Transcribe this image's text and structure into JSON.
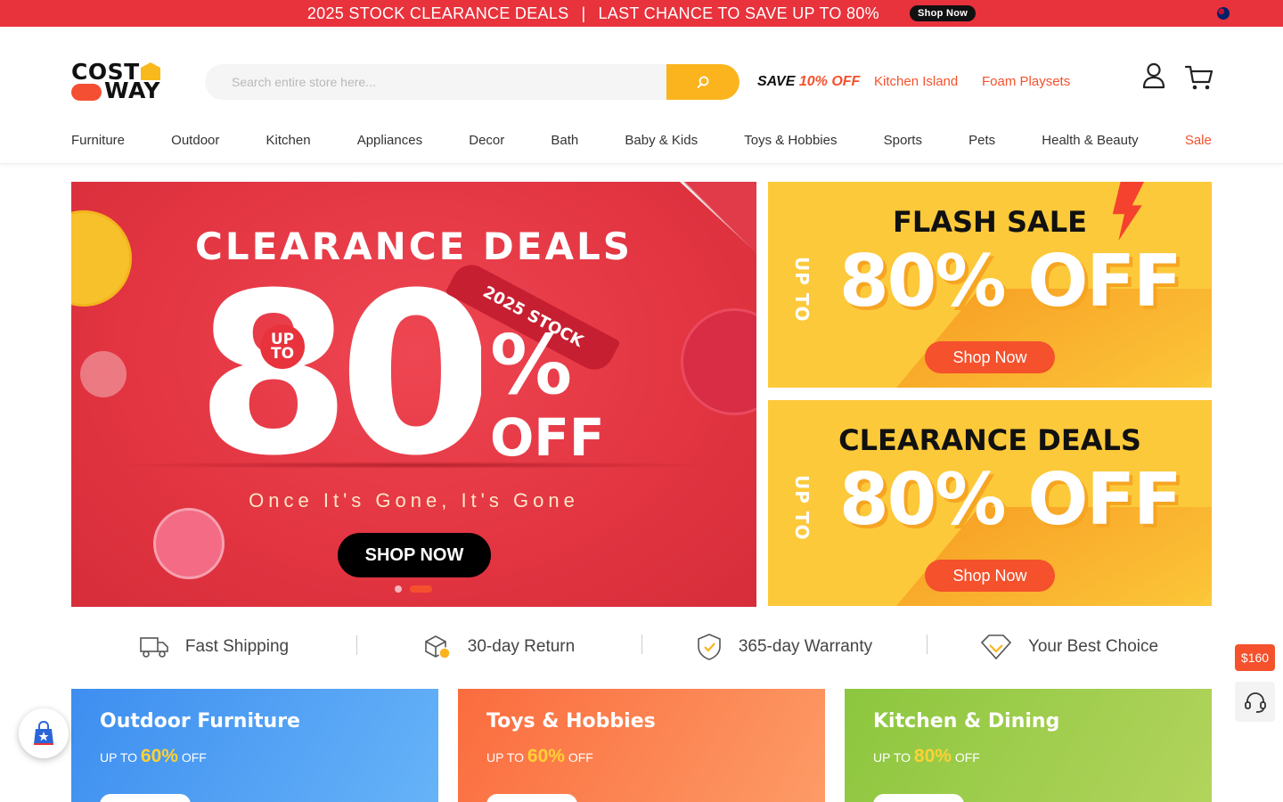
{
  "topbar": {
    "left_text": "2025 STOCK CLEARANCE DEALS",
    "separator": "|",
    "right_text": "LAST CHANCE TO SAVE UP TO 80%",
    "shop_label": "Shop Now",
    "flag_icon": "australia-flag-icon"
  },
  "header": {
    "logo_line1": "COST",
    "logo_line2": "WAY",
    "search_placeholder": "Search entire store here...",
    "promo_save": "SAVE",
    "promo_off": "10% OFF",
    "hot_links": [
      "Kitchen Island",
      "Foam Playsets"
    ]
  },
  "nav": {
    "items": [
      "Furniture",
      "Outdoor",
      "Kitchen",
      "Appliances",
      "Decor",
      "Bath",
      "Baby & Kids",
      "Toys & Hobbies",
      "Sports",
      "Pets",
      "Health & Beauty",
      "Sale"
    ]
  },
  "hero": {
    "title": "CLEARANCE DEALS",
    "up_to": "UP TO",
    "big_number": "80",
    "percent": "%",
    "off": "OFF",
    "ribbon": "2025 STOCK",
    "tagline": "Once It's Gone, It's Gone",
    "cta": "SHOP NOW",
    "slide_count": 2,
    "active_slide": 2
  },
  "side_banners": [
    {
      "heading": "FLASH SALE",
      "up_to": "UP TO",
      "value": "80% OFF",
      "cta": "Shop Now"
    },
    {
      "heading": "CLEARANCE DEALS",
      "up_to": "UP TO",
      "value": "80% OFF",
      "cta": "Shop Now"
    }
  ],
  "features": [
    {
      "label": "Fast Shipping",
      "icon": "truck-icon"
    },
    {
      "label": "30-day Return",
      "icon": "return-box-icon"
    },
    {
      "label": "365-day Warranty",
      "icon": "shield-check-icon"
    },
    {
      "label": "Your Best Choice",
      "icon": "diamond-icon"
    }
  ],
  "categories": [
    {
      "title": "Outdoor Furniture",
      "prefix": "UP TO",
      "percent": "60%",
      "suffix": "OFF",
      "color": "#4a9ef0"
    },
    {
      "title": "Toys & Hobbies",
      "prefix": "UP TO",
      "percent": "60%",
      "suffix": "OFF",
      "color": "#fa7a4a"
    },
    {
      "title": "Kitchen & Dining",
      "prefix": "UP TO",
      "percent": "80%",
      "suffix": "OFF",
      "color": "#8ec63f"
    }
  ],
  "floating": {
    "coupon_badge": "$160"
  },
  "colors": {
    "brand_red": "#e8323c",
    "accent_orange": "#f4512c",
    "accent_yellow": "#fbb41e"
  }
}
